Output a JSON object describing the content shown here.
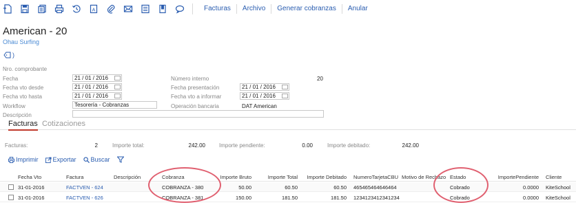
{
  "toolbar": {
    "icons": [
      "new-icon",
      "save-icon",
      "copy-icon",
      "print-icon",
      "history-icon",
      "document-a-icon",
      "attach-icon",
      "email-icon",
      "list-icon",
      "bookmark-icon",
      "comment-icon"
    ],
    "menu": [
      "Facturas",
      "Archivo",
      "Generar cobranzas",
      "Anular"
    ]
  },
  "header": {
    "title": "American - 20",
    "subtitle": "Ohau Surfing",
    "tag_text": ")"
  },
  "form": {
    "nro_comprobante_label": "Nro. comprobante",
    "fecha_label": "Fecha",
    "fecha_value": "21 / 01 / 2016",
    "fecha_vto_desde_label": "Fecha vto desde",
    "fecha_vto_desde_value": "21 / 01 / 2016",
    "fecha_vto_hasta_label": "Fecha vto hasta",
    "fecha_vto_hasta_value": "21 / 01 / 2016",
    "workflow_label": "Workflow",
    "workflow_value": "Tesorería - Cobranzas",
    "descripcion_label": "Descripción",
    "numero_interno_label": "Número interno",
    "numero_interno_value": "20",
    "fecha_presentacion_label": "Fecha presentación",
    "fecha_presentacion_value": "21 / 01 / 2016",
    "fecha_vto_informar_label": "Fecha vto a informar",
    "fecha_vto_informar_value": "21 / 01 / 2016",
    "operacion_bancaria_label": "Operación bancaria",
    "operacion_bancaria_value": "DAT American"
  },
  "tabs": [
    {
      "label": "Facturas",
      "active": true
    },
    {
      "label": "Cotizaciones",
      "active": false
    }
  ],
  "summary": {
    "facturas_label": "Facturas:",
    "facturas_value": "2",
    "importe_total_label": "Importe total:",
    "importe_total_value": "242.00",
    "importe_pendiente_label": "Importe pendiente:",
    "importe_pendiente_value": "0.00",
    "importe_debitado_label": "Importe debitado:",
    "importe_debitado_value": "242.00"
  },
  "actions": {
    "imprimir": "Imprimir",
    "exportar": "Exportar",
    "buscar": "Buscar"
  },
  "table": {
    "headers": [
      "Fecha Vto",
      "Factura",
      "Descripción",
      "Cobranza",
      "Importe Bruto",
      "Importe Total",
      "Importe Debitado",
      "NumeroTarjetaCBU",
      "Motivo de Rechazo",
      "Estado",
      "ImportePendiente",
      "Cliente"
    ],
    "rows": [
      [
        "31-01-2016",
        "FACTVEN - 624",
        "",
        "COBRANZA - 380",
        "50.00",
        "60.50",
        "60.50",
        "465465464646464",
        "",
        "Cobrado",
        "0.0000",
        "KiteSchool"
      ],
      [
        "31-01-2016",
        "FACTVEN - 626",
        "",
        "COBRANZA - 381",
        "150.00",
        "181.50",
        "181.50",
        "1234123412341234",
        "",
        "Cobrado",
        "0.0000",
        "KiteSchool"
      ]
    ]
  },
  "colors": {
    "link": "#2a5db0",
    "tab_active_underline": "#c0392b",
    "highlight_ellipse": "#e06070"
  }
}
